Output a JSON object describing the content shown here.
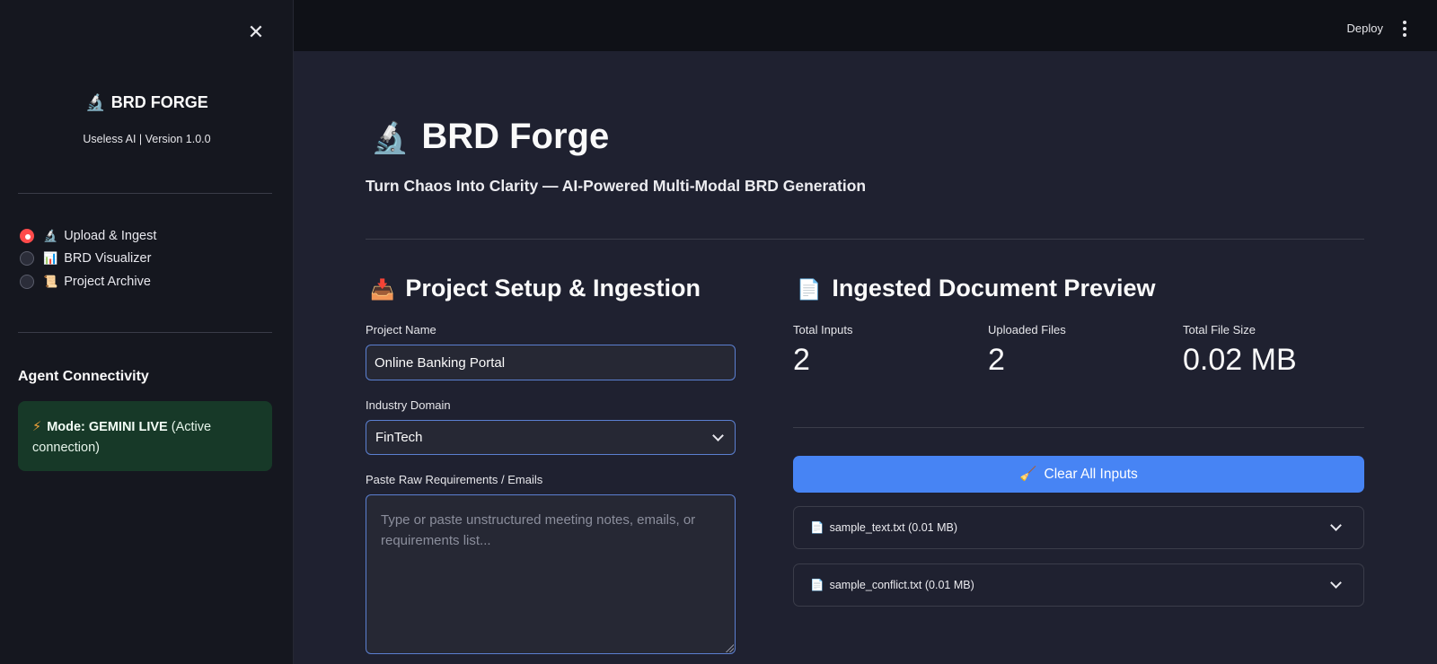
{
  "sidebar": {
    "close_icon": "close-icon",
    "brand_icon": "🔬",
    "brand": "BRD FORGE",
    "version": "Useless AI | Version 1.0.0",
    "nav": [
      {
        "icon": "🔬",
        "label": "Upload & Ingest",
        "selected": true
      },
      {
        "icon": "📊",
        "label": "BRD Visualizer",
        "selected": false
      },
      {
        "icon": "📜",
        "label": "Project Archive",
        "selected": false
      }
    ],
    "connectivity_heading": "Agent Connectivity",
    "status": {
      "icon": "⚡",
      "mode_label": "Mode: GEMINI LIVE",
      "mode_detail": "(Active connection)",
      "color": "#173928"
    }
  },
  "topbar": {
    "deploy_label": "Deploy",
    "menu_icon": "kebab-menu-icon"
  },
  "main": {
    "title_icon": "🔬",
    "title": "BRD Forge",
    "subtitle": "Turn Chaos Into Clarity — AI-Powered Multi-Modal BRD Generation",
    "setup": {
      "icon": "📥",
      "heading": "Project Setup & Ingestion",
      "project_name_label": "Project Name",
      "project_name_value": "Online Banking Portal",
      "industry_label": "Industry Domain",
      "industry_value": "FinTech",
      "requirements_label": "Paste Raw Requirements / Emails",
      "requirements_placeholder": "Type or paste unstructured meeting notes, emails, or requirements list..."
    },
    "preview": {
      "icon": "📄",
      "heading": "Ingested Document Preview",
      "metrics": [
        {
          "label": "Total Inputs",
          "value": "2"
        },
        {
          "label": "Uploaded Files",
          "value": "2"
        },
        {
          "label": "Total File Size",
          "value": "0.02 MB"
        }
      ],
      "clear_icon": "🧹",
      "clear_label": "Clear All Inputs",
      "accent_color": "#4784f4",
      "files": [
        {
          "icon": "📄",
          "label": "sample_text.txt (0.01 MB)"
        },
        {
          "icon": "📄",
          "label": "sample_conflict.txt (0.01 MB)"
        }
      ]
    }
  }
}
